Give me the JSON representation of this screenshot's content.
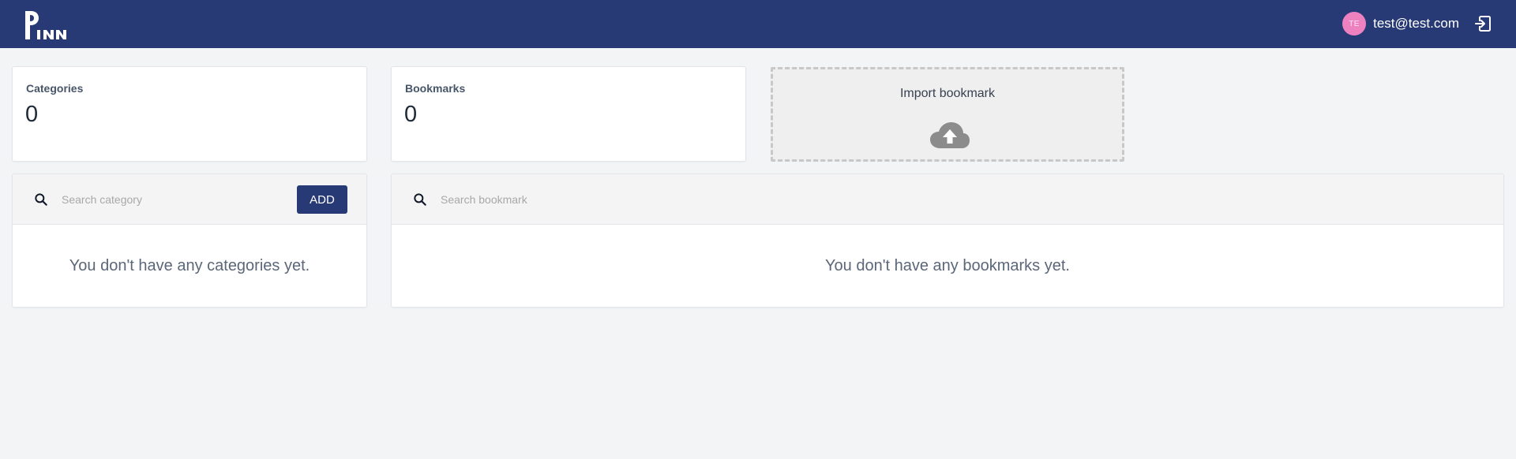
{
  "header": {
    "logo_text": "PINN",
    "avatar_initials": "TE",
    "user_email": "test@test.com"
  },
  "stats": {
    "categories_label": "Categories",
    "categories_value": "0",
    "bookmarks_label": "Bookmarks",
    "bookmarks_value": "0"
  },
  "import": {
    "label": "Import bookmark"
  },
  "categories_panel": {
    "search_placeholder": "Search category",
    "add_label": "ADD",
    "empty_message": "You don't have any categories yet."
  },
  "bookmarks_panel": {
    "search_placeholder": "Search bookmark",
    "empty_message": "You don't have any bookmarks yet."
  },
  "icons": {
    "search": "search-icon",
    "logout": "logout-icon",
    "upload": "cloud-upload-icon"
  },
  "colors": {
    "primary": "#283a75",
    "background": "#f3f4f6",
    "avatar": "#ee82c1"
  }
}
